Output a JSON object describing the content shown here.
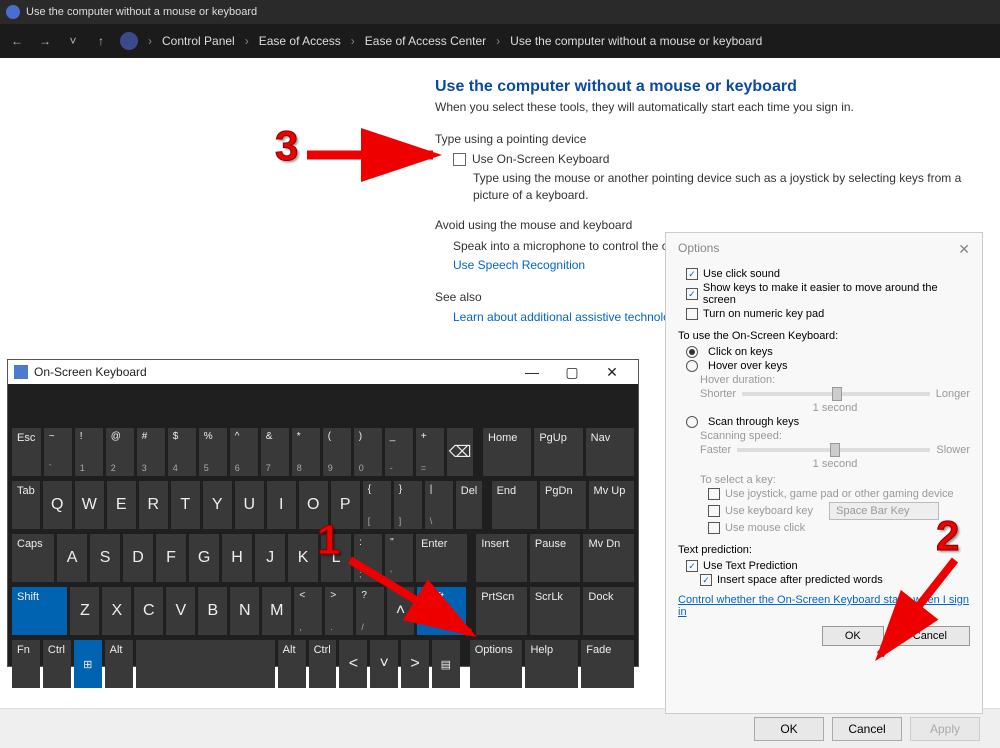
{
  "browser": {
    "window_title": "Use the computer without a mouse or keyboard",
    "breadcrumbs": [
      "Control Panel",
      "Ease of Access",
      "Ease of Access Center",
      "Use the computer without a mouse or keyboard"
    ]
  },
  "page": {
    "heading": "Use the computer without a mouse or keyboard",
    "sub": "When you select these tools, they will automatically start each time you sign in.",
    "type_section": "Type using a pointing device",
    "use_osk_label": "Use On-Screen Keyboard",
    "use_osk_desc": "Type using the mouse or another pointing device such as a joystick by selecting keys from a picture of a keyboard.",
    "avoid_section": "Avoid using the mouse and keyboard",
    "speak_desc": "Speak into a microphone to control the computer.",
    "speech_link": "Use Speech Recognition",
    "see_also": "See also",
    "learn_link": "Learn about additional assistive technologies"
  },
  "bottom_buttons": {
    "ok": "OK",
    "cancel": "Cancel",
    "apply": "Apply"
  },
  "osk": {
    "title": "On-Screen Keyboard",
    "nav_keys_col": [
      [
        "Home",
        "PgUp",
        "Nav"
      ],
      [
        "End",
        "PgDn",
        "Mv Up"
      ],
      [
        "Insert",
        "Pause",
        "Mv Dn"
      ],
      [
        "PrtScn",
        "ScrLk",
        "Dock"
      ],
      [
        "Options",
        "Help",
        "Fade"
      ]
    ],
    "row1_syms": [
      "~",
      "!",
      "@",
      "#",
      "$",
      "%",
      "^",
      "&",
      "*",
      "(",
      ")",
      "_",
      "+"
    ],
    "row1_nums": [
      "`",
      "1",
      "2",
      "3",
      "4",
      "5",
      "6",
      "7",
      "8",
      "9",
      "0",
      "-",
      "="
    ],
    "row2_letters": [
      "Q",
      "W",
      "E",
      "R",
      "T",
      "Y",
      "U",
      "I",
      "O",
      "P"
    ],
    "row2_extra": [
      [
        "{",
        "["
      ],
      [
        "}",
        "]"
      ],
      [
        "|",
        "\\"
      ]
    ],
    "row3_letters": [
      "A",
      "S",
      "D",
      "F",
      "G",
      "H",
      "J",
      "K",
      "L"
    ],
    "row3_extra": [
      [
        ":",
        ";"
      ],
      [
        "\"",
        "'"
      ]
    ],
    "row4_letters": [
      "Z",
      "X",
      "C",
      "V",
      "B",
      "N",
      "M"
    ],
    "row4_extra": [
      [
        "<",
        ","
      ],
      [
        ">",
        "."
      ],
      [
        "?",
        "/"
      ]
    ],
    "labels": {
      "esc": "Esc",
      "tab": "Tab",
      "caps": "Caps",
      "shift": "Shift",
      "enter": "Enter",
      "del": "Del",
      "fn": "Fn",
      "ctrl": "Ctrl",
      "alt": "Alt",
      "bksp": "⌫"
    }
  },
  "options": {
    "title": "Options",
    "click_sound": "Use click sound",
    "show_keys": "Show keys to make it easier to move around the screen",
    "numpad": "Turn on numeric key pad",
    "to_use": "To use the On-Screen Keyboard:",
    "click_on_keys": "Click on keys",
    "hover": "Hover over keys",
    "hover_dur": "Hover duration:",
    "shorter": "Shorter",
    "longer": "Longer",
    "one_sec": "1 second",
    "scan": "Scan through keys",
    "scan_speed": "Scanning speed:",
    "faster": "Faster",
    "slower": "Slower",
    "select_key": "To select a key:",
    "joystick": "Use joystick, game pad or other gaming device",
    "kb_key": "Use keyboard key",
    "space_bar": "Space Bar Key",
    "mouse_click": "Use mouse click",
    "text_pred": "Text prediction:",
    "use_text_pred": "Use Text Prediction",
    "insert_space": "Insert space after predicted words",
    "ctrl_link": "Control whether the On-Screen Keyboard starts when I sign in",
    "ok": "OK",
    "cancel": "Cancel"
  },
  "annotations": {
    "n1": "1",
    "n2": "2",
    "n3": "3"
  }
}
